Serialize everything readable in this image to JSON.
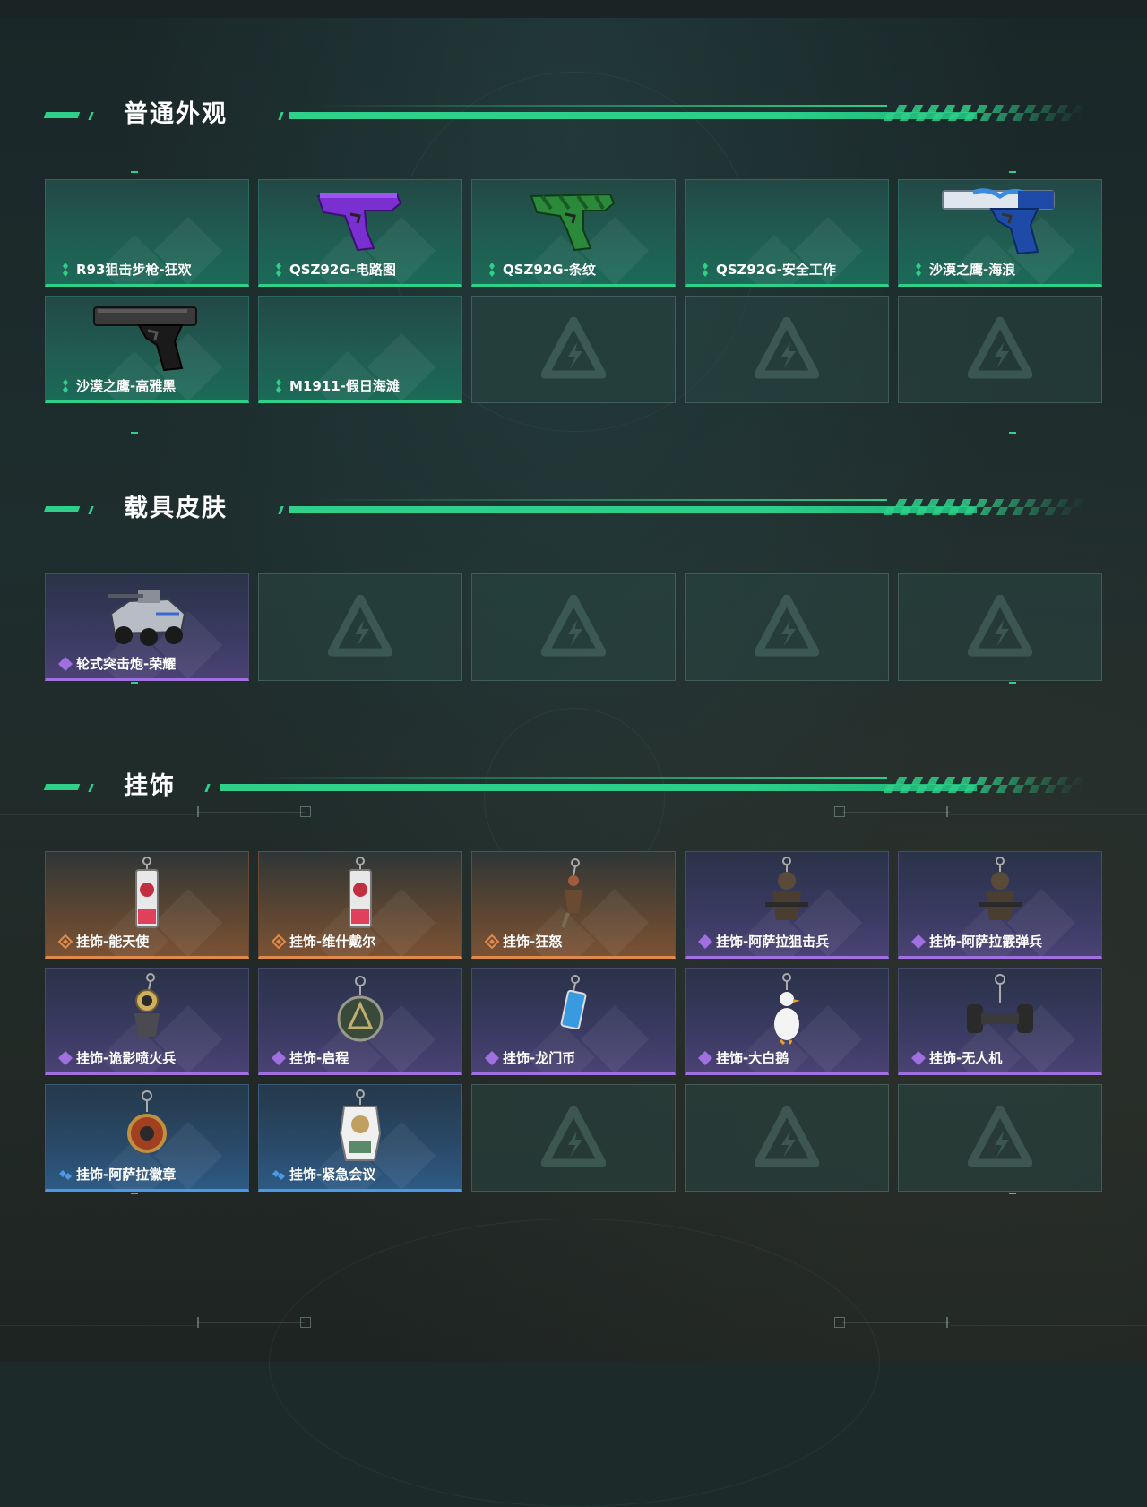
{
  "sections": {
    "weapon": {
      "title": "普通外观"
    },
    "vehicle": {
      "title": "载具皮肤"
    },
    "pendant": {
      "title": "挂饰"
    }
  },
  "weapon_items": [
    {
      "label": "R93狙击步枪-狂欢",
      "rarity": "green",
      "icon": "empty-slot"
    },
    {
      "label": "QSZ92G-电路图",
      "rarity": "green",
      "icon": "pistol-purple-icon"
    },
    {
      "label": "QSZ92G-条纹",
      "rarity": "green",
      "icon": "pistol-green-icon"
    },
    {
      "label": "QSZ92G-安全工作",
      "rarity": "green",
      "icon": "empty-slot"
    },
    {
      "label": "沙漠之鹰-海浪",
      "rarity": "green",
      "icon": "desert-eagle-blue-icon"
    },
    {
      "label": "沙漠之鹰-高雅黑",
      "rarity": "green",
      "icon": "desert-eagle-black-icon"
    },
    {
      "label": "M1911-假日海滩",
      "rarity": "green",
      "icon": "empty-slot"
    }
  ],
  "vehicle_items": [
    {
      "label": "轮式突击炮-荣耀",
      "rarity": "purple",
      "icon": "armored-vehicle-icon"
    }
  ],
  "pendant_items": [
    {
      "label": "挂饰-能天使",
      "rarity": "orange",
      "icon": "keychain-card-icon"
    },
    {
      "label": "挂饰-维什戴尔",
      "rarity": "orange",
      "icon": "keychain-card-icon"
    },
    {
      "label": "挂饰-狂怒",
      "rarity": "orange",
      "icon": "keychain-figure-icon"
    },
    {
      "label": "挂饰-阿萨拉狙击兵",
      "rarity": "purple",
      "icon": "keychain-soldier-icon"
    },
    {
      "label": "挂饰-阿萨拉霰弹兵",
      "rarity": "purple",
      "icon": "keychain-soldier-icon"
    },
    {
      "label": "挂饰-诡影喷火兵",
      "rarity": "purple",
      "icon": "keychain-flamer-icon"
    },
    {
      "label": "挂饰-启程",
      "rarity": "purple",
      "icon": "keychain-emblem-icon"
    },
    {
      "label": "挂饰-龙门币",
      "rarity": "purple",
      "icon": "keychain-coin-icon"
    },
    {
      "label": "挂饰-大白鹅",
      "rarity": "purple",
      "icon": "keychain-goose-icon"
    },
    {
      "label": "挂饰-无人机",
      "rarity": "purple",
      "icon": "keychain-drone-icon"
    },
    {
      "label": "挂饰-阿萨拉徽章",
      "rarity": "blue",
      "icon": "keychain-badge-icon"
    },
    {
      "label": "挂饰-紧急会议",
      "rarity": "blue",
      "icon": "keychain-character-icon"
    }
  ],
  "colors": {
    "accent": "#2fd08a",
    "rarity_green": "#2fd08a",
    "rarity_purple": "#a070e0",
    "rarity_orange": "#e08a4a",
    "rarity_blue": "#4a9ae8"
  }
}
